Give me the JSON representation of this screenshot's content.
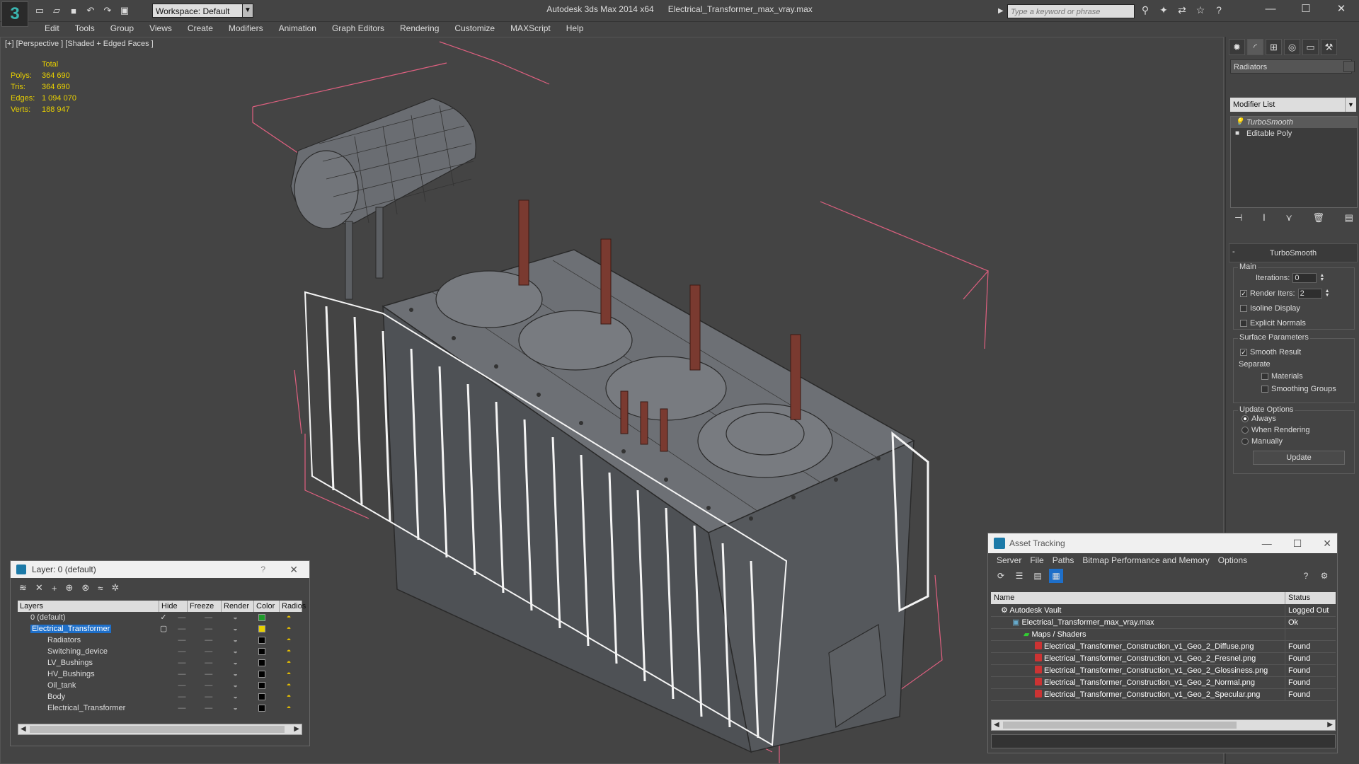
{
  "app": {
    "title": "Autodesk 3ds Max 2014 x64",
    "file": "Electrical_Transformer_max_vray.max",
    "logo": "3"
  },
  "toolbar": {
    "workspace": "Workspace: Default",
    "search_placeholder": "Type a keyword or phrase",
    "icons": [
      "new-icon",
      "open-icon",
      "save-icon",
      "undo-icon",
      "redo-icon",
      "project-icon"
    ]
  },
  "menu": [
    "Edit",
    "Tools",
    "Group",
    "Views",
    "Create",
    "Modifiers",
    "Animation",
    "Graph Editors",
    "Rendering",
    "Customize",
    "MAXScript",
    "Help"
  ],
  "viewport": {
    "label": "[+] [Perspective ] [Shaded + Edged Faces ]",
    "stats": {
      "header": "Total",
      "rows": [
        {
          "k": "Polys:",
          "v": "364 690"
        },
        {
          "k": "Tris:",
          "v": "364 690"
        },
        {
          "k": "Edges:",
          "v": "1 094 070"
        },
        {
          "k": "Verts:",
          "v": "188 947"
        }
      ]
    }
  },
  "command_panel": {
    "object_name": "Radiators",
    "modifier_list": "Modifier List",
    "stack": [
      "TurboSmooth",
      "Editable Poly"
    ],
    "rollout": "TurboSmooth",
    "main_label": "Main",
    "iterations_label": "Iterations:",
    "iterations": "0",
    "render_iters_label": "Render Iters:",
    "render_iters": "2",
    "isoline": "Isoline Display",
    "explicit_normals": "Explicit Normals",
    "surface_params": "Surface Parameters",
    "smooth_result": "Smooth Result",
    "separate": "Separate",
    "materials": "Materials",
    "smoothing_groups": "Smoothing Groups",
    "update_options": "Update Options",
    "always": "Always",
    "when_rendering": "When Rendering",
    "manually": "Manually",
    "update_btn": "Update"
  },
  "layer_window": {
    "title": "Layer: 0 (default)",
    "help": "?",
    "columns": [
      "Layers",
      "Hide",
      "Freeze",
      "Render",
      "Color",
      "Radios"
    ],
    "rows": [
      {
        "name": "0 (default)",
        "color": "#1e9b2a",
        "level": 1,
        "checked": true
      },
      {
        "name": "Electrical_Transformer",
        "color": "#e8d000",
        "level": 1,
        "selected": true
      },
      {
        "name": "Radiators",
        "color": "#000000",
        "level": 2
      },
      {
        "name": "Switching_device",
        "color": "#000000",
        "level": 2
      },
      {
        "name": "LV_Bushings",
        "color": "#000000",
        "level": 2
      },
      {
        "name": "HV_Bushings",
        "color": "#000000",
        "level": 2
      },
      {
        "name": "Oil_tank",
        "color": "#000000",
        "level": 2
      },
      {
        "name": "Body",
        "color": "#000000",
        "level": 2
      },
      {
        "name": "Electrical_Transformer",
        "color": "#000000",
        "level": 2
      }
    ]
  },
  "asset_window": {
    "title": "Asset Tracking",
    "menu": [
      "Server",
      "File",
      "Paths",
      "Bitmap Performance and Memory",
      "Options"
    ],
    "col_name": "Name",
    "col_status": "Status",
    "rows": [
      {
        "name": "Autodesk Vault",
        "status": "Logged Out",
        "level": 0,
        "icon": "vault-icon"
      },
      {
        "name": "Electrical_Transformer_max_vray.max",
        "status": "Ok",
        "level": 1,
        "icon": "max-file-icon"
      },
      {
        "name": "Maps / Shaders",
        "status": "",
        "level": 2,
        "icon": "maps-icon"
      },
      {
        "name": "Electrical_Transformer_Construction_v1_Geo_2_Diffuse.png",
        "status": "Found",
        "level": 3,
        "icon": "png-icon"
      },
      {
        "name": "Electrical_Transformer_Construction_v1_Geo_2_Fresnel.png",
        "status": "Found",
        "level": 3,
        "icon": "png-icon"
      },
      {
        "name": "Electrical_Transformer_Construction_v1_Geo_2_Glossiness.png",
        "status": "Found",
        "level": 3,
        "icon": "png-icon"
      },
      {
        "name": "Electrical_Transformer_Construction_v1_Geo_2_Normal.png",
        "status": "Found",
        "level": 3,
        "icon": "png-icon"
      },
      {
        "name": "Electrical_Transformer_Construction_v1_Geo_2_Specular.png",
        "status": "Found",
        "level": 3,
        "icon": "png-icon"
      }
    ]
  }
}
